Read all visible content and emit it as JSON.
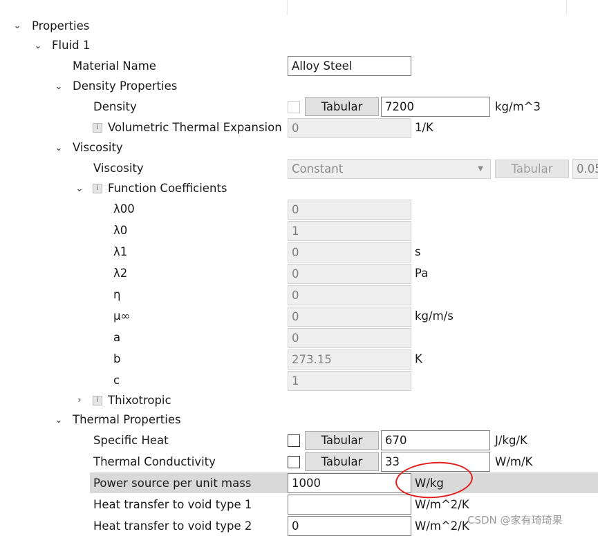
{
  "tree": {
    "properties": "Properties",
    "fluid": "Fluid 1",
    "material_name": {
      "label": "Material Name",
      "value": "Alloy Steel"
    },
    "density_props": "Density Properties",
    "density": {
      "label": "Density",
      "button": "Tabular",
      "value": "7200",
      "unit": "kg/m^3"
    },
    "vol_thermal": {
      "label": "Volumetric Thermal Expansion",
      "value": "0",
      "unit": "1/K"
    },
    "viscosity_group": "Viscosity",
    "viscosity": {
      "label": "Viscosity",
      "select": "Constant",
      "button": "Tabular",
      "value": "0.05"
    },
    "function_coeffs": "Function Coefficients",
    "coeffs": [
      {
        "label": "λ00",
        "value": "0",
        "unit": ""
      },
      {
        "label": "λ0",
        "value": "1",
        "unit": ""
      },
      {
        "label": "λ1",
        "value": "0",
        "unit": "s"
      },
      {
        "label": "λ2",
        "value": "0",
        "unit": "Pa"
      },
      {
        "label": "η",
        "value": "0",
        "unit": ""
      },
      {
        "label": "μ∞",
        "value": "0",
        "unit": "kg/m/s"
      },
      {
        "label": "a",
        "value": "0",
        "unit": ""
      },
      {
        "label": "b",
        "value": "273.15",
        "unit": "K"
      },
      {
        "label": "c",
        "value": "1",
        "unit": ""
      }
    ],
    "thixotropic": "Thixotropic",
    "thermal_props": "Thermal Properties",
    "specific_heat": {
      "label": "Specific Heat",
      "button": "Tabular",
      "value": "670",
      "unit": "J/kg/K"
    },
    "thermal_cond": {
      "label": "Thermal Conductivity",
      "button": "Tabular",
      "value": "33",
      "unit": "W/m/K"
    },
    "power_source": {
      "label": "Power source per unit mass",
      "value": "1000",
      "unit": "W/kg"
    },
    "htv1": {
      "label": "Heat transfer to void type 1",
      "value": "",
      "unit": "W/m^2/K"
    },
    "htv2": {
      "label": "Heat transfer to void type 2",
      "value": "0",
      "unit": "W/m^2/K"
    }
  },
  "icons": {
    "chevron_down": "chevron-down-icon",
    "chevron_right": "chevron-right-icon",
    "info": "info-icon"
  },
  "colors": {
    "annotation": "#e31d1d",
    "highlight_row": "#d9d9d9"
  },
  "watermark": "CSDN @家有琦琦果"
}
